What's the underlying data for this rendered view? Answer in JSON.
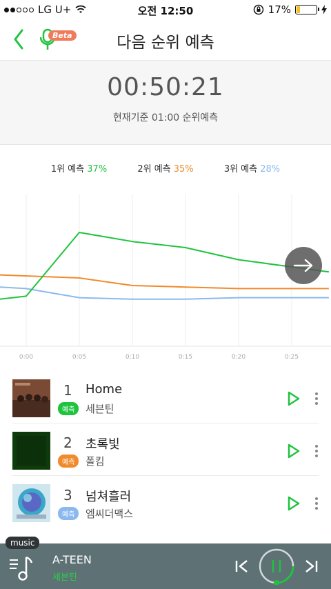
{
  "status": {
    "carrier": "LG U+",
    "time": "오전 12:50",
    "battery": "17%",
    "battery_level": 0.17
  },
  "header": {
    "title": "다음 순위 예측",
    "beta_label": "Beta"
  },
  "timer": {
    "countdown": "00:50:21",
    "subtitle": "현재기준 01:00 순위예측"
  },
  "legend": [
    {
      "label": "1위 예측",
      "pct": "37%",
      "color": "#1fc33e"
    },
    {
      "label": "2위 예측",
      "pct": "35%",
      "color": "#f08a2c"
    },
    {
      "label": "3위 예측",
      "pct": "28%",
      "color": "#8bb9ee"
    }
  ],
  "chart_data": {
    "type": "line",
    "x": [
      "0:00",
      "0:05",
      "0:10",
      "0:15",
      "0:20",
      "0:25"
    ],
    "x_ticks": [
      "0:00",
      "0:05",
      "0:10",
      "0:15",
      "0:20",
      "0:25"
    ],
    "ylim": [
      0,
      100
    ],
    "grid": "vertical",
    "series": [
      {
        "name": "1위 예측",
        "color": "#1fc33e",
        "values": [
          [
            -2.5,
            31
          ],
          [
            0,
            33
          ],
          [
            5,
            75
          ],
          [
            10,
            69
          ],
          [
            15,
            65
          ],
          [
            20,
            57
          ],
          [
            28.5,
            49
          ]
        ]
      },
      {
        "name": "2위 예측",
        "color": "#f08a2c",
        "values": [
          [
            -2.5,
            47
          ],
          [
            5,
            45
          ],
          [
            10,
            40
          ],
          [
            15,
            39
          ],
          [
            20,
            38
          ],
          [
            28.5,
            38
          ]
        ]
      },
      {
        "name": "3위 예측",
        "color": "#8bb9ee",
        "values": [
          [
            -2.5,
            39
          ],
          [
            0,
            38
          ],
          [
            5,
            32
          ],
          [
            10,
            31
          ],
          [
            15,
            31
          ],
          [
            20,
            32
          ],
          [
            28.5,
            32
          ]
        ]
      }
    ]
  },
  "list": [
    {
      "rank": "1",
      "song": "Home",
      "badge": "예측",
      "badge_color": "#1fc33e",
      "artist": "세븐틴"
    },
    {
      "rank": "2",
      "song": "초록빛",
      "badge": "예측",
      "badge_color": "#f08a2c",
      "artist": "폴킴"
    },
    {
      "rank": "3",
      "song": "넘쳐흘러",
      "badge": "예측",
      "badge_color": "#8bb9ee",
      "artist": "엠씨더맥스"
    }
  ],
  "player": {
    "tag": "music",
    "track": "A-TEEN",
    "artist": "세븐틴",
    "progress": 0.25
  },
  "colors": {
    "accent": "#1fc33e",
    "player_bg": "#5e7175"
  }
}
